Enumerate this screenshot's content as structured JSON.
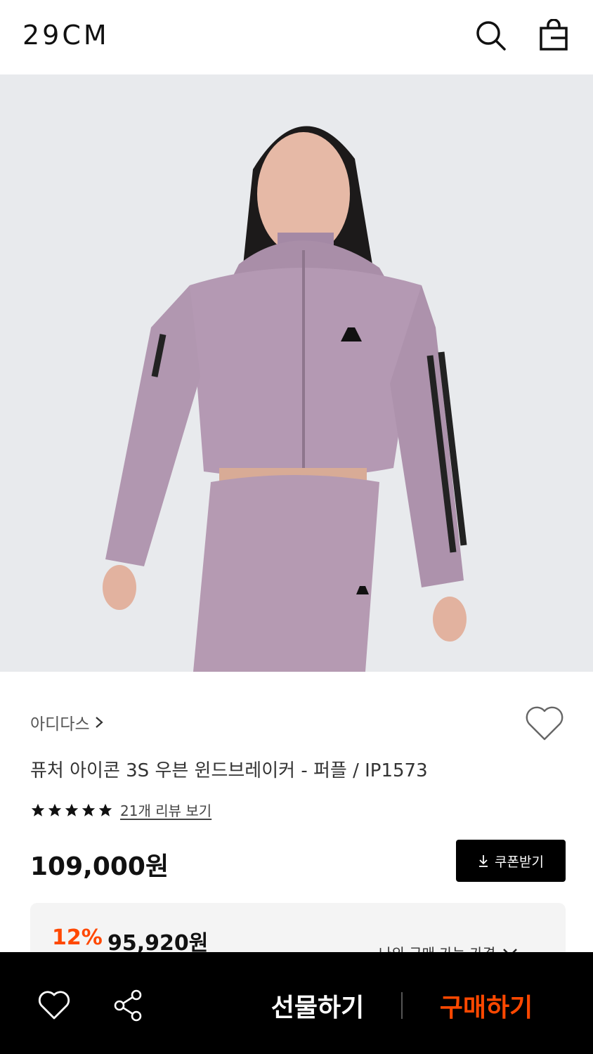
{
  "header": {
    "logo": "29CM",
    "page_progress": 0.9
  },
  "product": {
    "brand": "아디다스",
    "title": "퓨처 아이콘 3S 우븐 윈드브레이커 - 퍼플 / IP1573",
    "rating": 5,
    "review_link": "21개 리뷰 보기",
    "price": "109,000원",
    "coupon_button": "쿠폰받기",
    "discount_rate": "12%",
    "discount_price": "95,920원",
    "my_price_label": "나의 구매 가능 가격"
  },
  "bottom_bar": {
    "gift_button": "선물하기",
    "buy_button": "구매하기"
  },
  "colors": {
    "accent": "#ff4800",
    "progress": "#2fb84a",
    "jacket": "#b499b3"
  }
}
